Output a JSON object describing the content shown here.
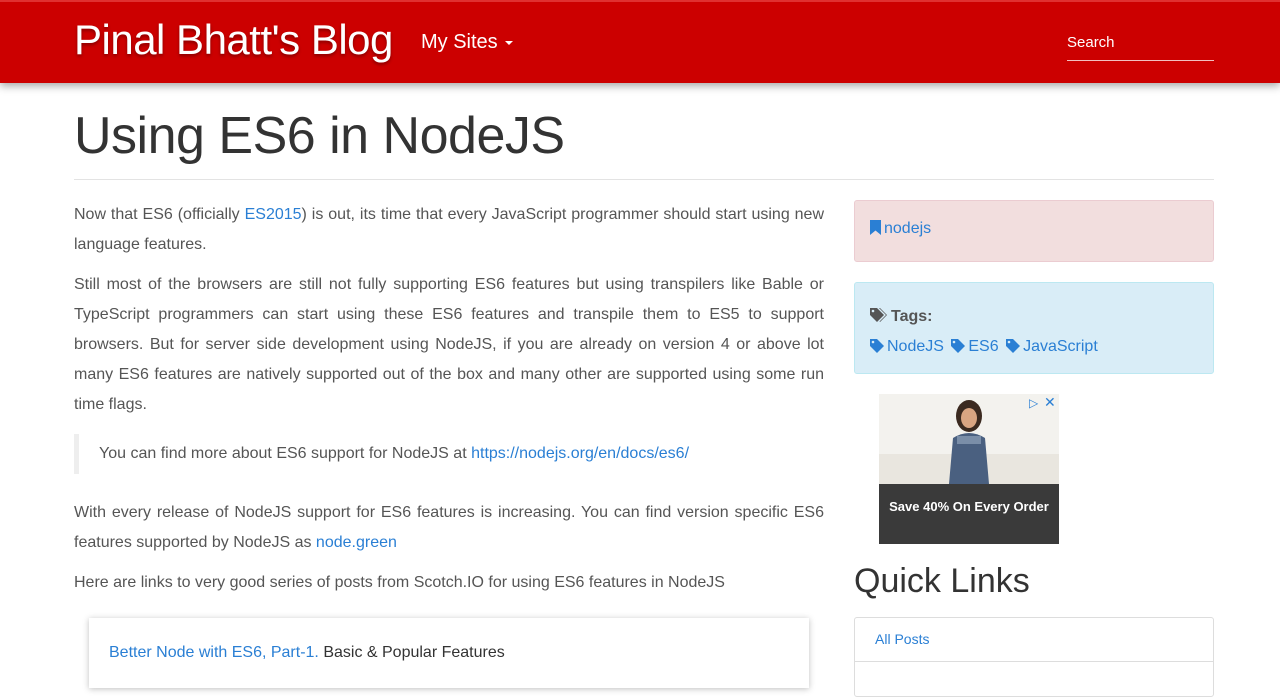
{
  "nav": {
    "brand": "Pinal Bhatt's Blog",
    "my_sites": "My Sites",
    "search_placeholder": "Search",
    "color": "#cc0000"
  },
  "post": {
    "title": "Using ES6 in NodeJS",
    "p1_before": "Now that ES6 (officially ",
    "p1_link": "ES2015",
    "p1_after": ") is out, its time that every JavaScript programmer should start using new language features.",
    "p2": "Still most of the browsers are still not fully supporting ES6 features but using transpilers like Bable or TypeScript programmers can start using these ES6 features and transpile them to ES5 to support browsers. But for server side development using NodeJS, if you are already on version 4 or above lot many ES6 features are natively supported out of the box and many other are supported using some run time flags.",
    "quote_text": "You can find more about ES6 support for NodeJS at ",
    "quote_link": "https://nodejs.org/en/docs/es6/",
    "p3_before": "With every release of NodeJS support for ES6 features is increasing. You can find version specific ES6 features supported by NodeJS as ",
    "p3_link": "node.green",
    "p4": "Here are links to very good series of posts from Scotch.IO for using ES6 features in NodeJS",
    "card_link": "Better Node with ES6, Part-1.",
    "card_text": " Basic & Popular Features"
  },
  "sidebar": {
    "category_icon": "bookmark-icon",
    "category": "nodejs",
    "tags_icon": "tags-icon",
    "tags_label": "Tags:",
    "tag_icon": "tag-icon",
    "tags": [
      "NodeJS",
      "ES6",
      "JavaScript"
    ],
    "ad_text": "Save 40% On Every Order",
    "quick_links_title": "Quick Links",
    "quick_links": [
      "All Posts"
    ]
  }
}
